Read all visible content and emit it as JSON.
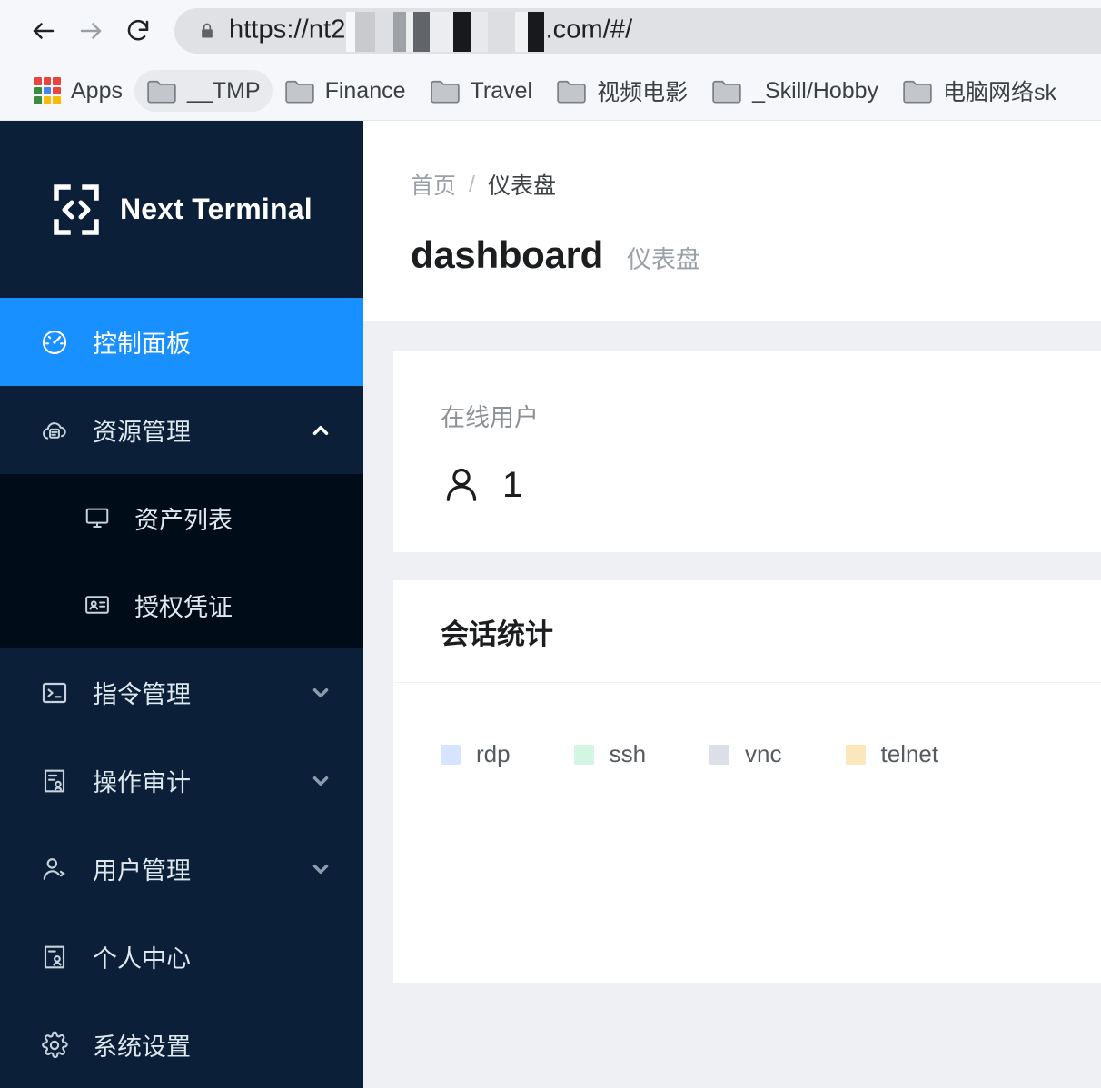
{
  "browser": {
    "back_label": "Back",
    "forward_label": "Forward",
    "reload_label": "Reload",
    "url_prefix": "https://nt2",
    "url_suffix": ".com/#/",
    "url_redacted": true,
    "secure": true,
    "bookmarks": [
      {
        "label": "Apps",
        "icon": "apps-grid-icon",
        "active": false
      },
      {
        "label": "__TMP",
        "icon": "folder-icon",
        "active": true
      },
      {
        "label": "Finance",
        "icon": "folder-icon",
        "active": false
      },
      {
        "label": "Travel",
        "icon": "folder-icon",
        "active": false
      },
      {
        "label": "视频电影",
        "icon": "folder-icon",
        "active": false
      },
      {
        "label": "_Skill/Hobby",
        "icon": "folder-icon",
        "active": false
      },
      {
        "label": "电脑网络sk",
        "icon": "folder-icon",
        "active": false
      }
    ]
  },
  "sidebar": {
    "brand": "Next Terminal",
    "brand_icon": "code-brackets-logo",
    "items": [
      {
        "label": "控制面板",
        "icon": "dashboard-gauge-icon",
        "active": true,
        "expandable": false
      },
      {
        "label": "资源管理",
        "icon": "cloud-server-icon",
        "active": false,
        "expandable": true,
        "expanded": true,
        "children": [
          {
            "label": "资产列表",
            "icon": "monitor-icon"
          },
          {
            "label": "授权凭证",
            "icon": "id-card-icon"
          }
        ]
      },
      {
        "label": "指令管理",
        "icon": "terminal-icon",
        "active": false,
        "expandable": true,
        "expanded": false
      },
      {
        "label": "操作审计",
        "icon": "audit-icon",
        "active": false,
        "expandable": true,
        "expanded": false
      },
      {
        "label": "用户管理",
        "icon": "user-add-icon",
        "active": false,
        "expandable": true,
        "expanded": false
      },
      {
        "label": "个人中心",
        "icon": "profile-icon",
        "active": false,
        "expandable": false
      },
      {
        "label": "系统设置",
        "icon": "gear-icon",
        "active": false,
        "expandable": false
      }
    ]
  },
  "main": {
    "breadcrumb": {
      "home": "首页",
      "separator": "/",
      "current": "仪表盘"
    },
    "title": "dashboard",
    "subtitle": "仪表盘",
    "online_users": {
      "label": "在线用户",
      "icon": "person-icon",
      "value": "1"
    },
    "sessions": {
      "title": "会话统计"
    }
  },
  "chart_data": {
    "type": "bar",
    "title": "会话统计",
    "categories": [],
    "series": [
      {
        "name": "rdp",
        "color": "#d6e4ff",
        "values": []
      },
      {
        "name": "ssh",
        "color": "#d3f5e4",
        "values": []
      },
      {
        "name": "vnc",
        "color": "#dcdfe8",
        "values": []
      },
      {
        "name": "telnet",
        "color": "#fbe7bc",
        "values": []
      }
    ],
    "legend_position": "top-left",
    "grid": false,
    "xlabel": "",
    "ylabel": ""
  },
  "colors": {
    "accent": "#1890ff",
    "sidebar_bg": "#0b2038",
    "submenu_bg": "#000c17",
    "page_bg": "#eff0f3",
    "card_bg": "#ffffff"
  }
}
